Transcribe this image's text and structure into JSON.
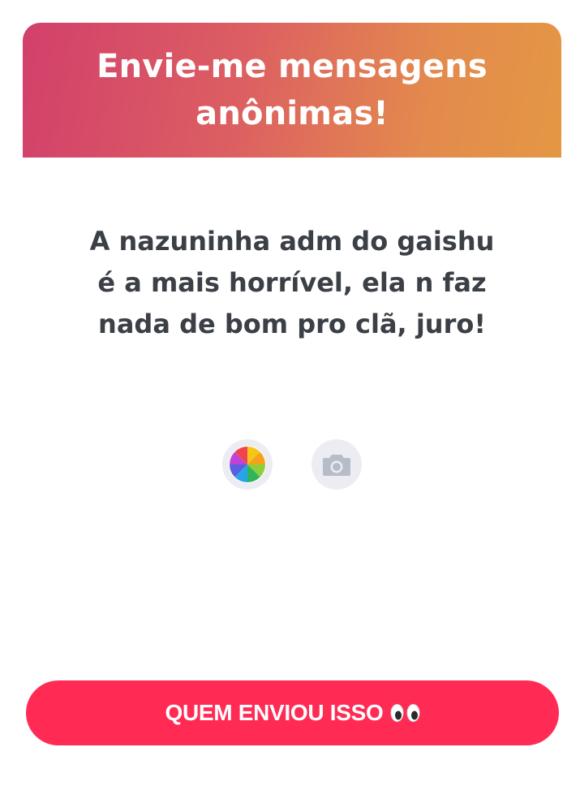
{
  "header": {
    "title_line1": "Envie-me mensagens",
    "title_line2": "anônimas!",
    "gradient_start": "#d2406b",
    "gradient_end": "#e49744"
  },
  "message": {
    "line1": "A nazuninha adm do gaishu",
    "line2": "é a mais horrível, ela n faz",
    "line3": "nada de bom pro clã, juro!"
  },
  "tools": [
    {
      "icon": "color-wheel-icon"
    },
    {
      "icon": "camera-icon"
    }
  ],
  "cta": {
    "label": "QUEM ENVIOU ISSO",
    "icon": "eyes-emoji-icon",
    "color": "#ff2b55"
  }
}
